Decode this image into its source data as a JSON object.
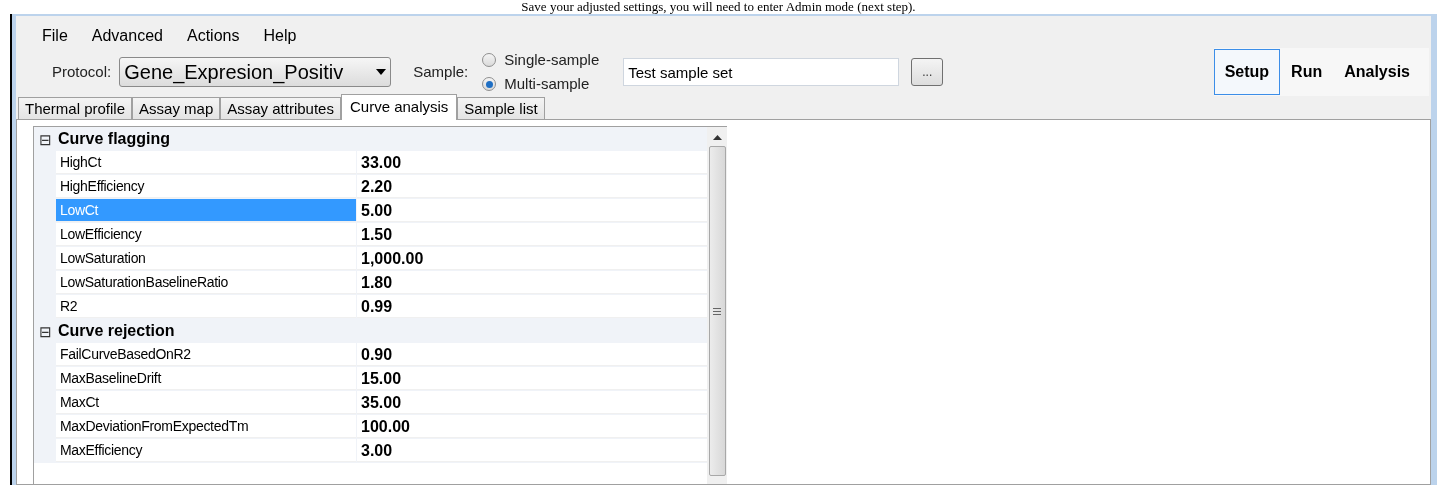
{
  "document_text": "Save your adjusted settings, you will need to enter Admin mode (next step).",
  "menu": [
    "File",
    "Advanced",
    "Actions",
    "Help"
  ],
  "toolbar": {
    "protocol_label": "Protocol:",
    "protocol_value": "Gene_Expresion_Positiv",
    "sample_label": "Sample:",
    "sample_options": [
      {
        "label": "Single-sample",
        "selected": false
      },
      {
        "label": "Multi-sample",
        "selected": true
      }
    ],
    "sample_set": "Test sample set",
    "browse_button": "...",
    "modes": [
      {
        "label": "Setup",
        "selected": true
      },
      {
        "label": "Run",
        "selected": false
      },
      {
        "label": "Analysis",
        "selected": false
      }
    ]
  },
  "tabs": [
    {
      "label": "Thermal profile",
      "selected": false
    },
    {
      "label": "Assay map",
      "selected": false
    },
    {
      "label": "Assay attributes",
      "selected": false
    },
    {
      "label": "Curve analysis",
      "selected": true
    },
    {
      "label": "Sample list",
      "selected": false
    }
  ],
  "property_grid": {
    "categories": [
      {
        "name": "Curve flagging",
        "expanded": true,
        "toggle": "⊟",
        "properties": [
          {
            "name": "HighCt",
            "value": "33.00",
            "selected": false
          },
          {
            "name": "HighEfficiency",
            "value": "2.20",
            "selected": false
          },
          {
            "name": "LowCt",
            "value": "5.00",
            "selected": true
          },
          {
            "name": "LowEfficiency",
            "value": "1.50",
            "selected": false
          },
          {
            "name": "LowSaturation",
            "value": "1,000.00",
            "selected": false
          },
          {
            "name": "LowSaturationBaselineRatio",
            "value": "1.80",
            "selected": false
          },
          {
            "name": "R2",
            "value": "0.99",
            "selected": false
          }
        ]
      },
      {
        "name": "Curve rejection",
        "expanded": true,
        "toggle": "⊟",
        "properties": [
          {
            "name": "FailCurveBasedOnR2",
            "value": "0.90",
            "selected": false
          },
          {
            "name": "MaxBaselineDrift",
            "value": "15.00",
            "selected": false
          },
          {
            "name": "MaxCt",
            "value": "35.00",
            "selected": false
          },
          {
            "name": "MaxDeviationFromExpectedTm",
            "value": "100.00",
            "selected": false
          },
          {
            "name": "MaxEfficiency",
            "value": "3.00",
            "selected": false
          }
        ]
      }
    ]
  }
}
